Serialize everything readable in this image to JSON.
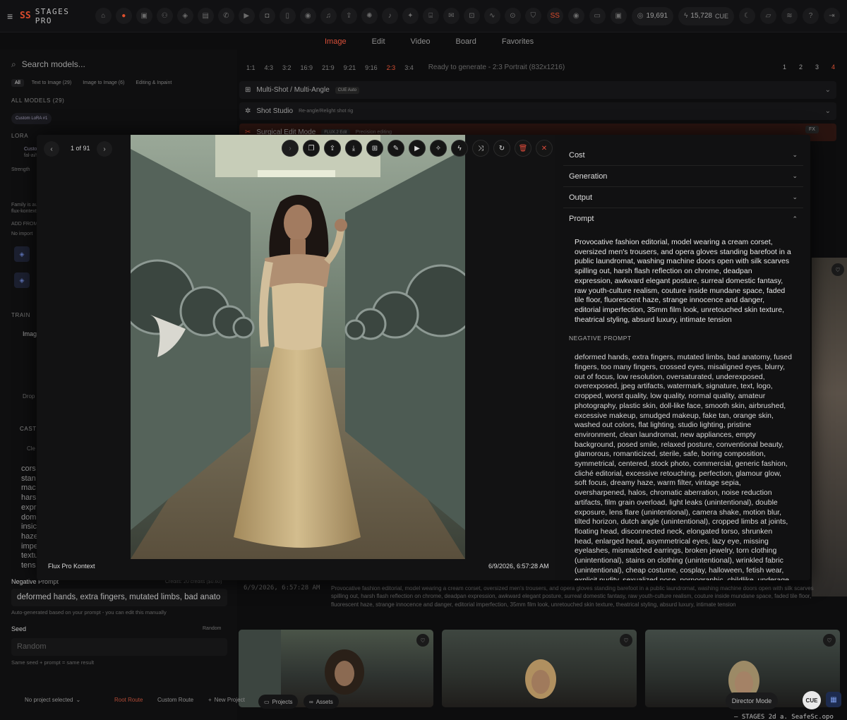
{
  "app": {
    "menu_icon": "menu-icon",
    "logo_mark": "SS",
    "logo_text": "STAGES PRO",
    "tool_icons": [
      "home-icon",
      "circle-icon",
      "box-icon",
      "users-icon",
      "layers-icon",
      "film-icon",
      "chat-icon",
      "video-icon",
      "camera-icon",
      "phone-icon",
      "eye-icon",
      "music-icon",
      "share-icon",
      "brain-icon",
      "mic-icon",
      "bulb-icon",
      "building-icon",
      "message-icon",
      "scan-icon",
      "activity-icon",
      "pin-icon",
      "shield-icon"
    ],
    "stat_credits": "19,691",
    "stat_cue": "15,728",
    "cue_label": "CUE"
  },
  "mode_tabs": [
    "Image",
    "Edit",
    "Video",
    "Board",
    "Favorites"
  ],
  "sidebar": {
    "search_placeholder": "Search models...",
    "filters": [
      "All",
      "Text to Image (29)",
      "Image to Image (6)",
      "Editing & Inpaint"
    ],
    "all_models": "ALL MODELS (29)",
    "selected_chip": "Custom LoRA #1",
    "lora_label": "LORA",
    "lora_chip": "Custo",
    "lora_sub": "fal-ai/fl",
    "strength": "Strength",
    "family_note": "Family is aut",
    "family_sub": "flux-kontext",
    "add_from": "ADD FROM",
    "no_import": "No import",
    "training": "TRAIN",
    "image_item": "Imag",
    "drop_label": "Drop",
    "cast_label": "CAST",
    "clear_label": "Cle",
    "prompt_fragment": [
      "cors",
      "stan",
      "mac",
      "hars",
      "expr",
      "dom",
      "insic",
      "haze",
      "impe",
      "textu",
      "tens"
    ],
    "negative_label": "Negative Prompt",
    "credits_note": "Credits: 20 credits ($0.60)",
    "negative_value": "deformed hands, extra fingers, mutated limbs, bad anato",
    "auto_note": "Auto-generated based on your prompt - you can edit this manually",
    "seed_label": "Seed",
    "seed_right": "Random",
    "seed_placeholder": "Random",
    "seed_note": "Same seed + prompt = same result"
  },
  "main": {
    "ratios": [
      "1:1",
      "4:3",
      "3:2",
      "16:9",
      "21:9",
      "9:21",
      "9:16",
      "2:3",
      "3:4"
    ],
    "active_ratio": "2:3",
    "ready_text": "Ready to generate - 2:3 Portrait (832x1216)",
    "pages": [
      "1",
      "2",
      "3",
      "4"
    ],
    "active_page": "4",
    "multishot": "Multi-Shot / Multi-Angle",
    "multishot_badge": "CUE Auto",
    "shot_studio": "Shot Studio",
    "shot_studio_sub": "Re-angle/Relight shot rig",
    "surgical": "Surgical Edit Mode",
    "surgical_badge": "FLUX.2 Edit",
    "surgical_sub": "Precision editing",
    "fx_label": "FX",
    "meta_time": "6/9/2026, 6:57:28 AM",
    "meta_prompt": "Provocative fashion editorial, model wearing a cream corset, oversized men's trousers, and opera gloves standing barefoot in a public laundromat, washing machine doors open with silk scarves spilling out, harsh flash reflection on chrome, deadpan expression, awkward elegant posture, surreal domestic fantasy, raw youth-culture realism, couture inside mundane space, faded tile floor, fluorescent haze, strange innocence and danger, editorial imperfection, 35mm film look, unretouched skin texture, theatrical styling, absurd luxury, intimate tension"
  },
  "bottombar": {
    "project": "No project selected",
    "root_route": "Root Route",
    "custom_route": "Custom Route",
    "new_project": "New Project",
    "projects": "Projects",
    "assets": "Assets",
    "director": "Director Mode",
    "cue_button": "CUE",
    "footer_text": "— STAGES 2d a. SeafeSc.opo"
  },
  "modal": {
    "counter": "1 of 91",
    "model_name": "Flux Pro Kontext",
    "timestamp": "6/9/2026, 6:57:28 AM",
    "tools": [
      "chevron-right-icon",
      "copy-icon",
      "share-icon",
      "download-icon",
      "expand-icon",
      "wand-icon",
      "video-icon",
      "sparkle-icon",
      "bolt-icon",
      "shuffle-icon",
      "refresh-icon",
      "trash-icon",
      "close-icon"
    ],
    "accordions": [
      "Cost",
      "Generation",
      "Output",
      "Prompt"
    ],
    "prompt": "Provocative fashion editorial, model wearing a cream corset, oversized men's trousers, and opera gloves standing barefoot in a public laundromat, washing machine doors open with silk scarves spilling out, harsh flash reflection on chrome, deadpan expression, awkward elegant posture, surreal domestic fantasy, raw youth-culture realism, couture inside mundane space, faded tile floor, fluorescent haze, strange innocence and danger, editorial imperfection, 35mm film look, unretouched skin texture, theatrical styling, absurd luxury, intimate tension",
    "negative_title": "NEGATIVE PROMPT",
    "negative_prompt": "deformed hands, extra fingers, mutated limbs, bad anatomy, fused fingers, too many fingers, crossed eyes, misaligned eyes, blurry, out of focus, low resolution, oversaturated, underexposed, overexposed, jpeg artifacts, watermark, signature, text, logo, cropped, worst quality, low quality, normal quality, amateur photography, plastic skin, doll-like face, smooth skin, airbrushed, excessive makeup, smudged makeup, fake tan, orange skin, washed out colors, flat lighting, studio lighting, pristine environment, clean laundromat, new appliances, empty background, posed smile, relaxed posture, conventional beauty, glamorous, romanticized, sterile, safe, boring composition, symmetrical, centered, stock photo, commercial, generic fashion, cliché editorial, excessive retouching, perfection, glamour glow, soft focus, dreamy haze, warm filter, vintage sepia, oversharpened, halos, chromatic aberration, noise reduction artifacts, film grain overload, light leaks (unintentional), double exposure, lens flare (unintentional), camera shake, motion blur, tilted horizon, dutch angle (unintentional), cropped limbs at joints, floating head, disconnected neck, elongated torso, shrunken head, enlarged head, asymmetrical eyes, lazy eye, missing eyelashes, mismatched earrings, broken jewelry, torn clothing (unintentional), stains on clothing (unintentional), wrinkled fabric (unintentional), cheap costume, cosplay, halloween, fetish wear, explicit nudity, sexualized pose, pornographic, childlike, underage appearance, male gaze pandering, conventional seduction, playful wink, tongue out, duck face, peace sign, selfie"
  },
  "colors": {
    "accent": "#d94a2c",
    "background": "#0d0d0e",
    "panel": "#111112"
  }
}
